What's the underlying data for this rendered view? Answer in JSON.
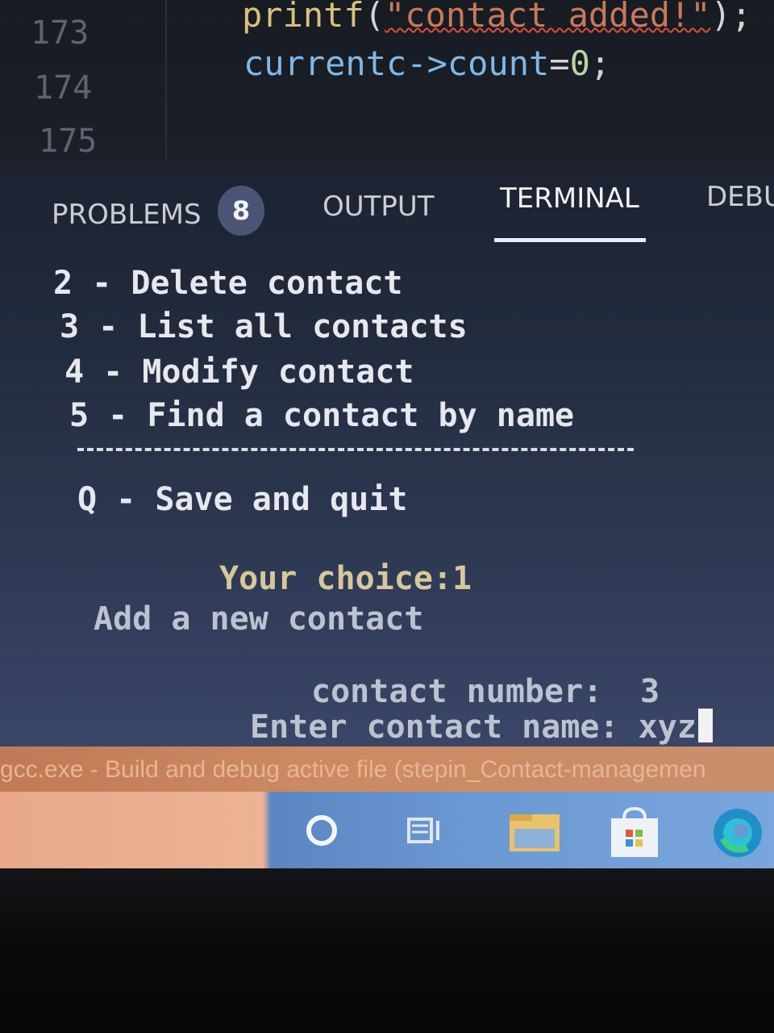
{
  "editor": {
    "lines": [
      {
        "num": "173",
        "code_fn": "printf",
        "code_open": "(",
        "code_str": "\"contact added!\"",
        "code_close": ");"
      },
      {
        "num": "174",
        "code_var": "currentc->count",
        "code_eq": "=",
        "code_num": "0",
        "code_end": ";"
      },
      {
        "num": "175"
      }
    ]
  },
  "panel": {
    "tabs": {
      "problems": "PROBLEMS",
      "problems_count": "8",
      "output": "OUTPUT",
      "terminal": "TERMINAL",
      "debug": "DEBU"
    },
    "terminal": {
      "menu": [
        "2 - Delete contact",
        "3 - List all contacts",
        "4 - Modify contact",
        "5 - Find a contact by name"
      ],
      "quit": "Q - Save and quit",
      "choice": "Your choice:1",
      "add_heading": "Add a new contact",
      "number_label": "contact number:",
      "number_value": "3",
      "name_prompt": "Enter contact name: ",
      "name_input": "xyz"
    }
  },
  "status_bar": {
    "text": "gcc.exe - Build and debug active file (stepin_Contact-managemen"
  },
  "taskbar": {
    "icons": [
      "search-icon",
      "task-view-icon",
      "file-explorer-icon",
      "store-icon",
      "edge-icon"
    ]
  },
  "colors": {
    "status_bar": "#c98660",
    "taskbar": "#6a98d2",
    "terminal_text": "#e6e8ee"
  }
}
